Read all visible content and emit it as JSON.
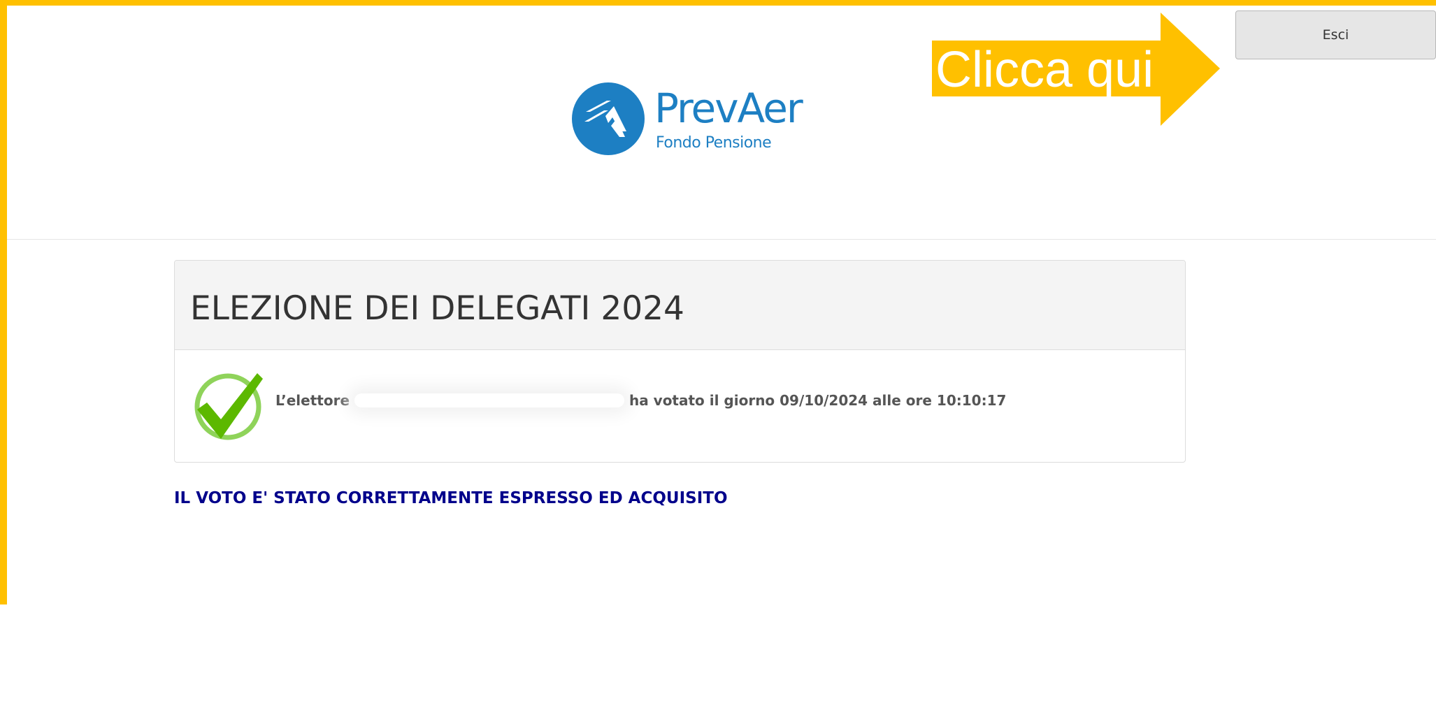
{
  "header": {
    "logo": {
      "name": "PrevAer",
      "subtitle": "Fondo Pensione",
      "mark_icon": "prevaer-logo-icon"
    },
    "annotation": {
      "label": "Clicca qui",
      "icon": "right-arrow-icon",
      "color": "#ffc000"
    },
    "exit_button": {
      "label": "Esci"
    }
  },
  "panel": {
    "title": "ELEZIONE DEI DELEGATI 2024",
    "status_icon": "check-mark-icon",
    "voter_prefix": "L’elettore",
    "voter_suffix": "ha votato il giorno 09/10/2024 alle ore 10:10:17"
  },
  "confirmation": {
    "message": "IL VOTO E' STATO CORRETTAMENTE ESPRESSO ED ACQUISITO"
  },
  "colors": {
    "highlight": "#ffc000",
    "brand": "#1d7fc3",
    "confirmation": "#00008b",
    "check": "#5cb800"
  }
}
